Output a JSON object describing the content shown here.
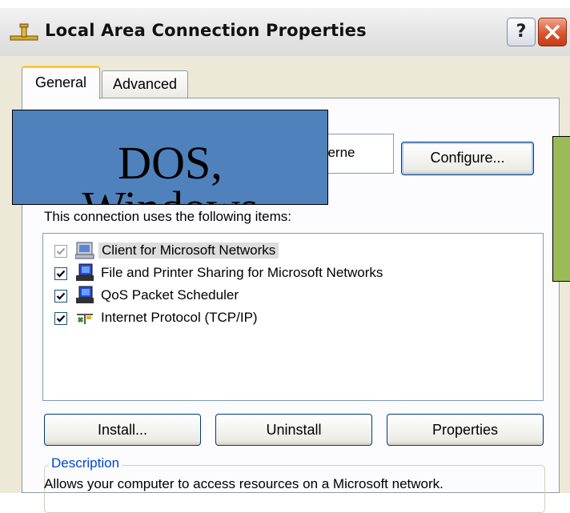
{
  "window": {
    "title": "Local Area Connection Properties",
    "help_label": "?",
    "icon": "network-connection-icon"
  },
  "tabs": [
    {
      "label": "General",
      "active": true
    },
    {
      "label": "Advanced",
      "active": false
    }
  ],
  "connect_using": {
    "adapter_partial": "herne",
    "configure_label": "Configure..."
  },
  "items_label": "This connection uses the following items:",
  "items": [
    {
      "label": "Client for Microsoft Networks",
      "checked": true,
      "disabled": true,
      "selected": true,
      "icon": "network-client-icon"
    },
    {
      "label": "File and Printer Sharing for Microsoft Networks",
      "checked": true,
      "disabled": false,
      "selected": false,
      "icon": "network-service-icon"
    },
    {
      "label": "QoS Packet Scheduler",
      "checked": true,
      "disabled": false,
      "selected": false,
      "icon": "network-service-icon"
    },
    {
      "label": "Internet Protocol (TCP/IP)",
      "checked": true,
      "disabled": false,
      "selected": false,
      "icon": "protocol-icon"
    }
  ],
  "buttons": {
    "install": "Install...",
    "uninstall": "Uninstall",
    "properties": "Properties"
  },
  "description": {
    "legend": "Description",
    "text": "Allows your computer to access resources on a Microsoft network."
  },
  "overlay": {
    "line1": "DOS,",
    "line2": "Windows"
  },
  "colors": {
    "overlay_blue": "#4f81bd",
    "overlay_green": "#9bbb59",
    "dialog_face": "#ece9d8",
    "legend_blue": "#0046d5"
  }
}
